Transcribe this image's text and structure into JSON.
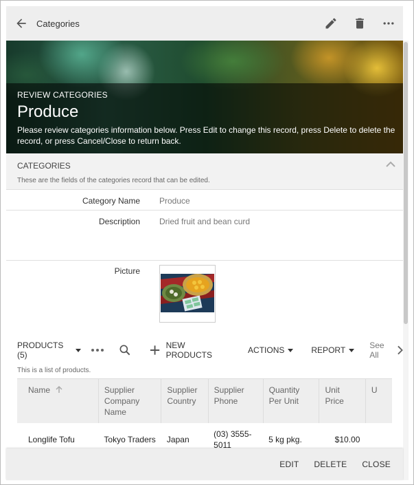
{
  "topbar": {
    "title": "Categories",
    "icons": [
      "back-arrow-icon",
      "pencil-icon",
      "trash-icon",
      "more-icon"
    ]
  },
  "banner": {
    "kicker": "REVIEW CATEGORIES",
    "title": "Produce",
    "description": "Please review categories information below. Press Edit to change this record, press Delete to delete the record, or press Cancel/Close to return back."
  },
  "section": {
    "title": "CATEGORIES",
    "subtitle": "These are the fields of the categories record that can be edited."
  },
  "fields": {
    "category_name": {
      "label": "Category Name",
      "value": "Produce"
    },
    "description": {
      "label": "Description",
      "value": "Dried fruit and bean curd"
    },
    "picture": {
      "label": "Picture"
    }
  },
  "products": {
    "title": "PRODUCTS (5)",
    "new_label": "NEW PRODUCTS",
    "actions_label": "ACTIONS",
    "report_label": "REPORT",
    "see_all_label": "See All",
    "description": "This is a list of products.",
    "columns": [
      "Name",
      "Supplier Company Name",
      "Supplier Country",
      "Supplier Phone",
      "Quantity Per Unit",
      "Unit Price",
      "U"
    ],
    "rows": [
      {
        "name": "Longlife Tofu",
        "company": "Tokyo Traders",
        "country": "Japan",
        "phone": "(03) 3555-5011",
        "qty": "5 kg pkg.",
        "price": "$10.00"
      }
    ]
  },
  "bottombar": {
    "edit": "EDIT",
    "delete": "DELETE",
    "close": "CLOSE"
  }
}
